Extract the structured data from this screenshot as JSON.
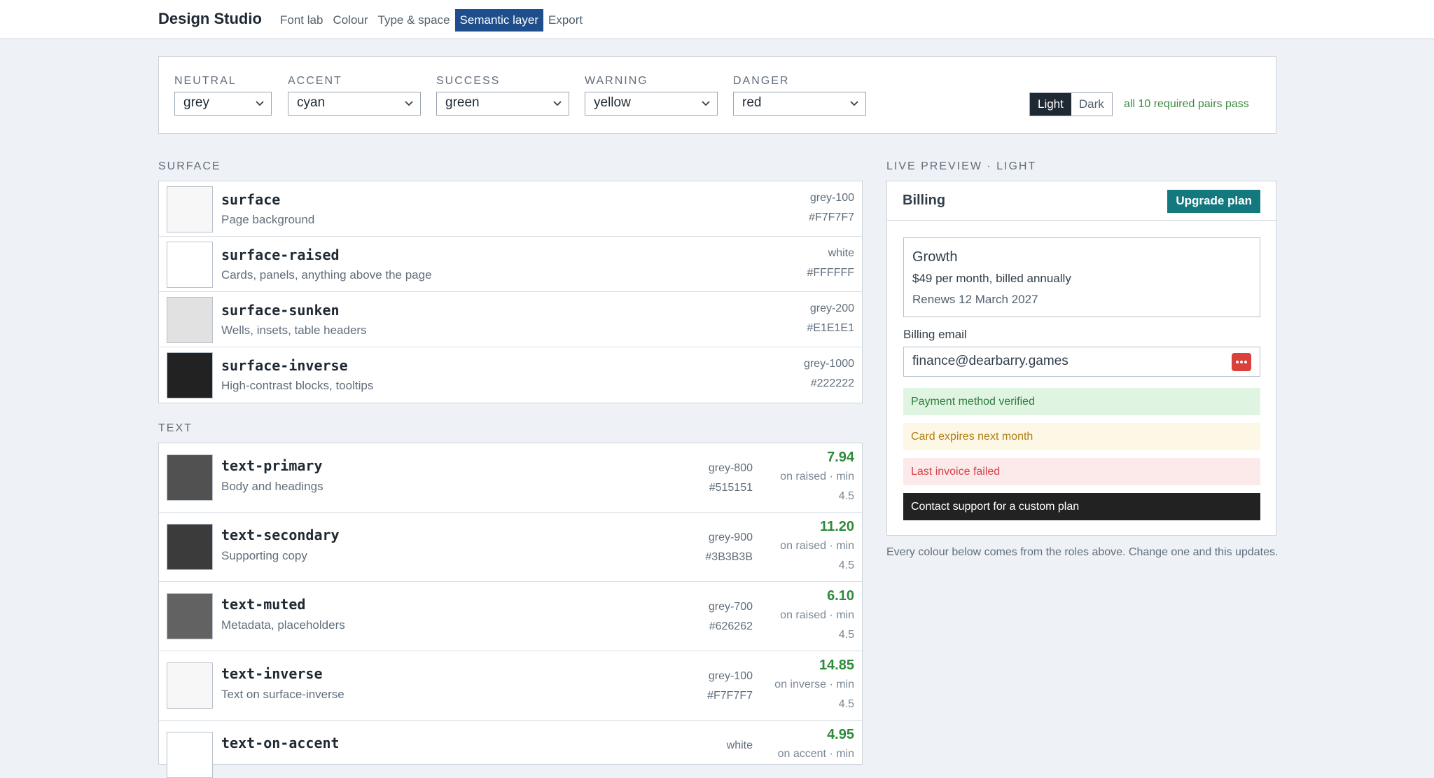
{
  "app": {
    "title": "Design Studio",
    "nav": [
      "Font lab",
      "Colour",
      "Type & space",
      "Semantic layer",
      "Export"
    ],
    "active_nav": "Semantic layer"
  },
  "roles": {
    "items": [
      {
        "label": "NEUTRAL",
        "value": "grey"
      },
      {
        "label": "ACCENT",
        "value": "cyan"
      },
      {
        "label": "SUCCESS",
        "value": "green"
      },
      {
        "label": "WARNING",
        "value": "yellow"
      },
      {
        "label": "DANGER",
        "value": "red"
      }
    ],
    "mode": {
      "light": "Light",
      "dark": "Dark",
      "selected": "Light"
    },
    "status": "all 10 required pairs pass"
  },
  "surface": {
    "heading": "SURFACE",
    "tokens": [
      {
        "name": "surface",
        "desc": "Page background",
        "ref": "grey-100",
        "hex": "#F7F7F7",
        "color": "#F7F7F7"
      },
      {
        "name": "surface-raised",
        "desc": "Cards, panels, anything above the page",
        "ref": "white",
        "hex": "#FFFFFF",
        "color": "#FFFFFF"
      },
      {
        "name": "surface-sunken",
        "desc": "Wells, insets, table headers",
        "ref": "grey-200",
        "hex": "#E1E1E1",
        "color": "#E1E1E1"
      },
      {
        "name": "surface-inverse",
        "desc": "High-contrast blocks, tooltips",
        "ref": "grey-1000",
        "hex": "#222222",
        "color": "#222222"
      }
    ]
  },
  "text": {
    "heading": "TEXT",
    "tokens": [
      {
        "name": "text-primary",
        "desc": "Body and headings",
        "ref": "grey-800",
        "hex": "#515151",
        "color": "#515151",
        "ratio": "7.94",
        "ratio_note": "on raised · min",
        "min": "4.5"
      },
      {
        "name": "text-secondary",
        "desc": "Supporting copy",
        "ref": "grey-900",
        "hex": "#3B3B3B",
        "color": "#3B3B3B",
        "ratio": "11.20",
        "ratio_note": "on raised · min",
        "min": "4.5"
      },
      {
        "name": "text-muted",
        "desc": "Metadata, placeholders",
        "ref": "grey-700",
        "hex": "#626262",
        "color": "#626262",
        "ratio": "6.10",
        "ratio_note": "on raised · min",
        "min": "4.5"
      },
      {
        "name": "text-inverse",
        "desc": "Text on surface-inverse",
        "ref": "grey-100",
        "hex": "#F7F7F7",
        "color": "#F7F7F7",
        "ratio": "14.85",
        "ratio_note": "on inverse · min",
        "min": "4.5"
      },
      {
        "name": "text-on-accent",
        "desc": "",
        "ref": "white",
        "hex": "",
        "color": "#FFFFFF",
        "ratio": "4.95",
        "ratio_note": "on accent · min",
        "min": ""
      }
    ]
  },
  "preview": {
    "heading": "LIVE PREVIEW · LIGHT",
    "title": "Billing",
    "upgrade": "Upgrade plan",
    "plan": "Growth",
    "price": "$49 per month, billed annually",
    "renews": "Renews 12 March 2027",
    "email_label": "Billing email",
    "email_value": "finance@dearbarry.games",
    "status_success": "Payment method verified",
    "status_warning": "Card expires next month",
    "status_danger": "Last invoice failed",
    "status_inverse": "Contact support for a custom plan",
    "note": "Every colour below comes from the roles above. Change one and this updates."
  }
}
